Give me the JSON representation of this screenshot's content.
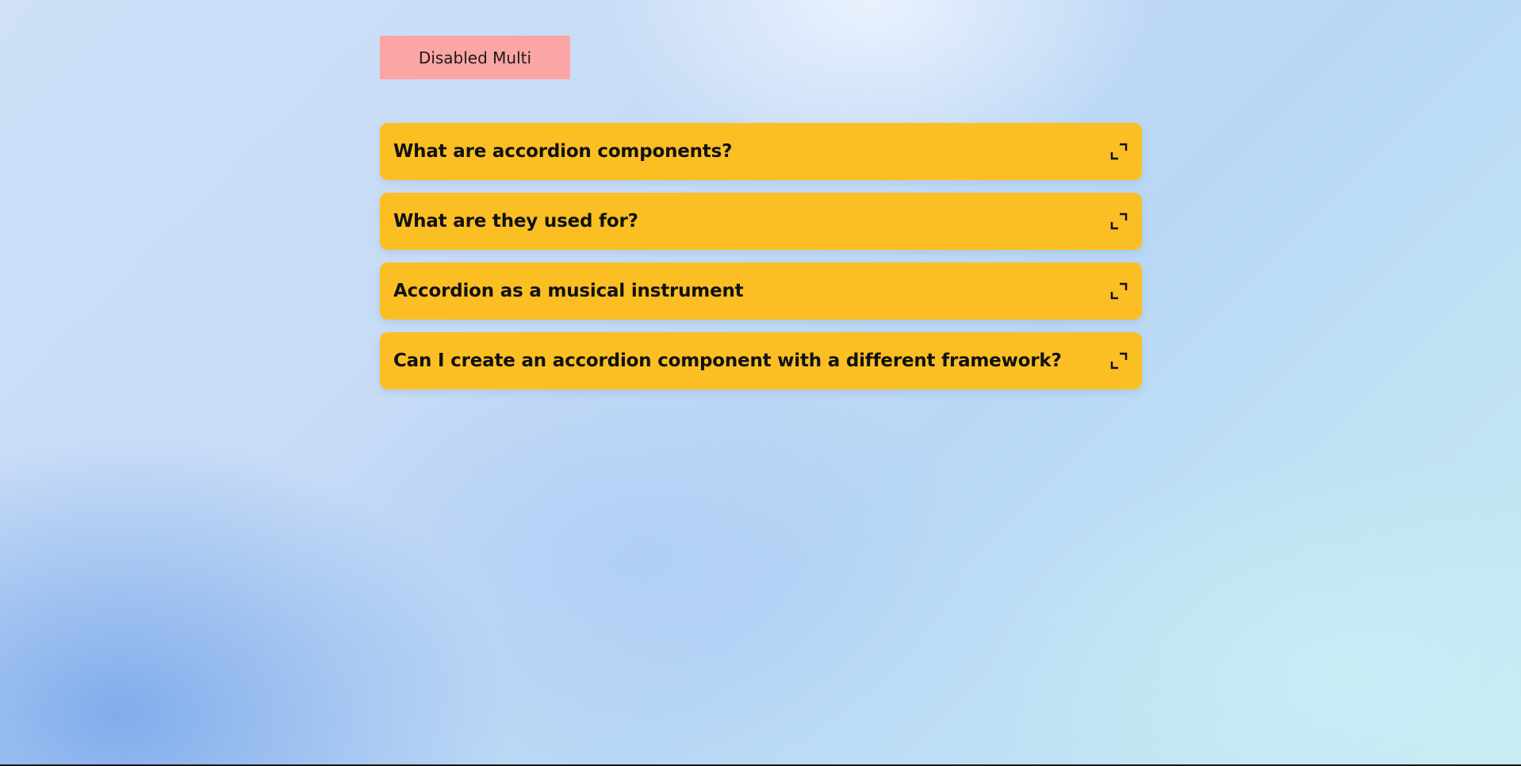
{
  "toggle": {
    "label": "Disabled Multi"
  },
  "accordion": {
    "items": [
      {
        "title": "What are accordion components?",
        "icon": "expand-icon"
      },
      {
        "title": "What are they used for?",
        "icon": "expand-icon"
      },
      {
        "title": "Accordion as a musical instrument",
        "icon": "expand-icon"
      },
      {
        "title": "Can I create an accordion component with a different framework?",
        "icon": "expand-icon"
      }
    ]
  },
  "colors": {
    "toggle_bg": "#fca5a5",
    "item_bg": "#fbbf24",
    "text": "#111111"
  }
}
